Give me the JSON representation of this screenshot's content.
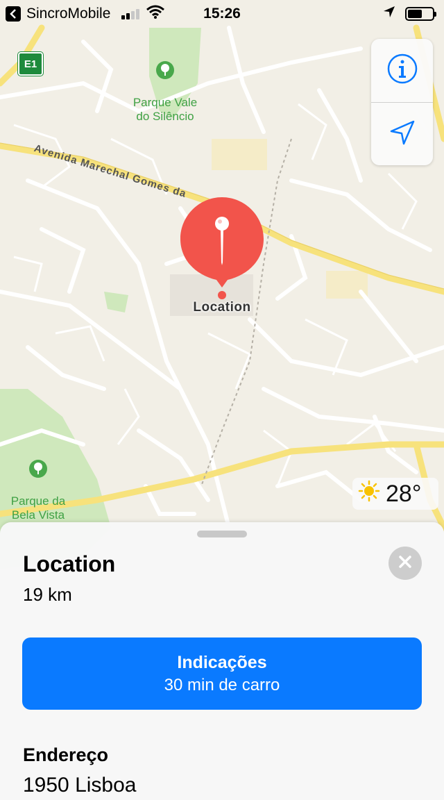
{
  "status_bar": {
    "back_app": "SincroMobile",
    "time": "15:26"
  },
  "map": {
    "parks": [
      {
        "name": "Parque Vale\ndo Silêncio"
      },
      {
        "name": "Parque da\nBela Vista"
      }
    ],
    "road_label": "Avenida Marechal Gomes da",
    "highway_shield": "E1",
    "pin_label": "Location",
    "colors": {
      "pin": "#f2544b",
      "park": "#b8dfa3",
      "road_major": "#f7e27c",
      "map_bg": "#f2efe6"
    }
  },
  "map_controls": {
    "info_icon": "info-icon",
    "location_icon": "location-arrow-icon"
  },
  "weather": {
    "icon": "sun-icon",
    "temperature": "28°"
  },
  "sheet": {
    "title": "Location",
    "distance": "19 km",
    "directions": {
      "label": "Indicações",
      "sublabel": "30 min de carro",
      "color": "#0a7aff"
    },
    "address_title": "Endereço",
    "address_value": "1950 Lisboa"
  }
}
